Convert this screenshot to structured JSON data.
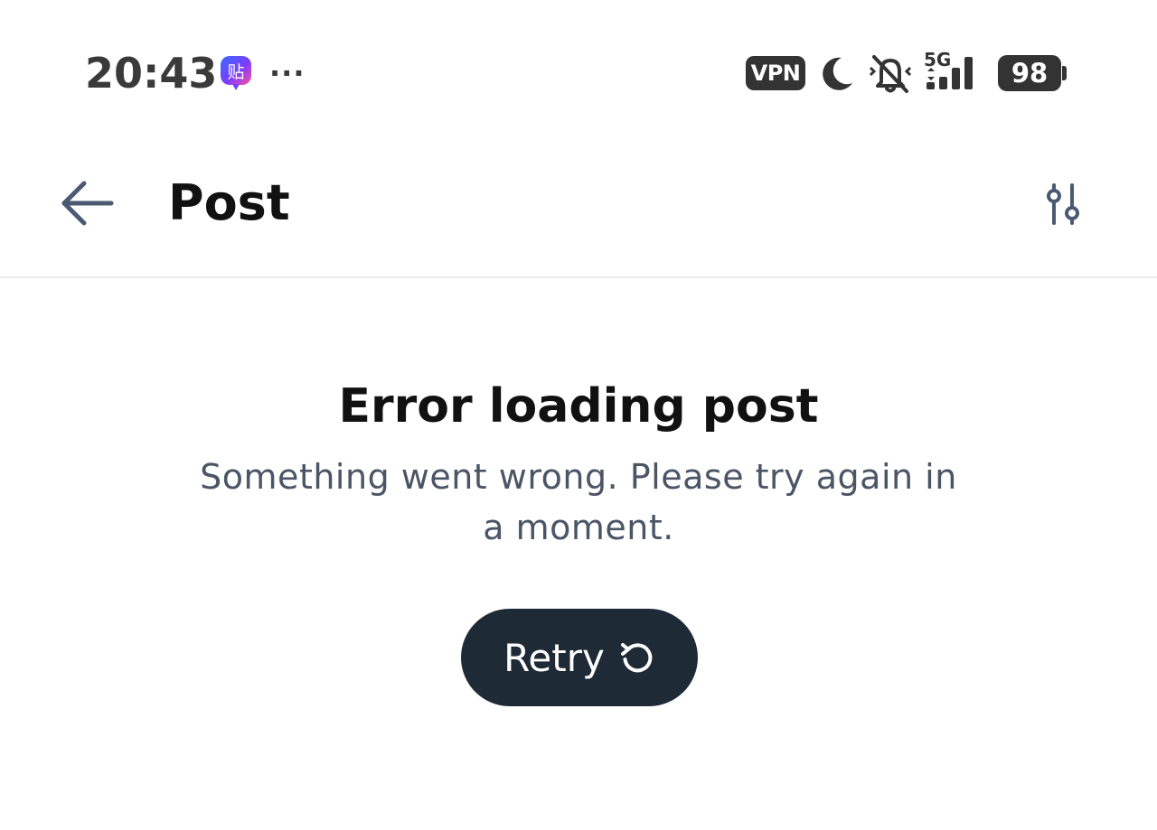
{
  "status_bar": {
    "time": "20:43",
    "app_badge_char": "贴",
    "more": "···",
    "vpn_label": "VPN",
    "network_label": "5G",
    "battery_level": "98",
    "icons": [
      "app-notification-icon",
      "moon-icon",
      "bell-off-icon",
      "signal-icon",
      "battery-icon"
    ]
  },
  "header": {
    "title": "Post",
    "back_icon": "arrow-left-icon",
    "settings_icon": "sliders-icon"
  },
  "error": {
    "title": "Error loading post",
    "message": "Something went wrong. Please try again in a moment.",
    "retry_label": "Retry",
    "retry_icon": "rotate-ccw-icon"
  },
  "colors": {
    "title_text": "#111111",
    "message_text": "#4a5566",
    "button_bg": "#1f2a37",
    "button_text": "#ffffff",
    "icon_color": "#4b5a72",
    "divider": "#ececec"
  }
}
